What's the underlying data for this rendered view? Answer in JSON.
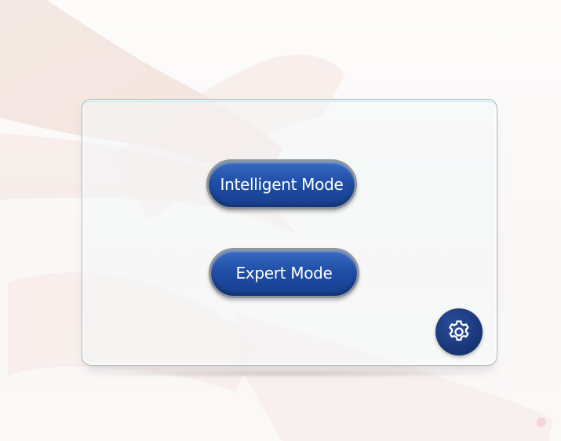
{
  "screen": {
    "background": "legs-photo"
  },
  "modes": {
    "intelligent_label": "Intelligent Mode",
    "expert_label": "Expert Mode"
  },
  "settings": {
    "icon": "gear-icon"
  },
  "colors": {
    "button_blue": "#1f4fa8",
    "button_border": "#8f969c",
    "settings_blue": "#1a3779",
    "panel_border": "#a9b6bb"
  }
}
